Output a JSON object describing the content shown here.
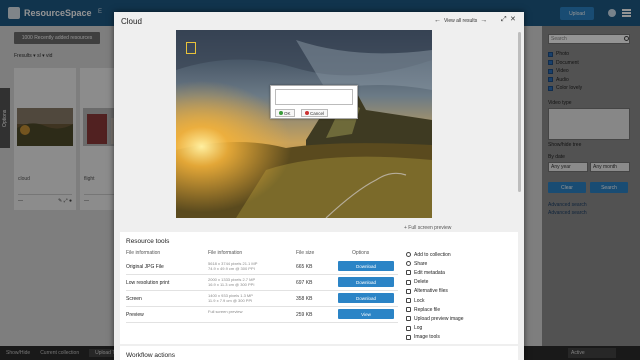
{
  "app": {
    "name": "ResourceSpace",
    "nav_text": "E",
    "upload_label": "Upload"
  },
  "background": {
    "collection_label": "1000 Recently added resources",
    "sort_text": "Fresults    ▾ sl   ▾   vid",
    "side_tab_label": "Options",
    "cards": [
      {
        "title": "cloud"
      },
      {
        "title": "flight"
      }
    ]
  },
  "sidebar": {
    "search_placeholder": "Search",
    "checks": [
      "Photo",
      "Document",
      "Video",
      "Audio",
      "Color lovely"
    ],
    "video_type_label": "Video type",
    "show_hide_label": "Show/hide tree",
    "by_date_label": "By date",
    "date_from": "Any year",
    "date_to": "Any month",
    "clear_label": "Clear",
    "search_label": "Search",
    "link1": "Advanced search",
    "link2": "Advanced search"
  },
  "bottombar": {
    "items": [
      "Show/Hide",
      "Current collection",
      "Upload Things",
      "▾"
    ],
    "right_select": "Active"
  },
  "modal": {
    "title": "Cloud",
    "nav_prev": "←",
    "nav_label": "View all results",
    "nav_next": "→",
    "full_preview_link": "+ Full screen preview",
    "annotate": {
      "ok_label": "OK",
      "cancel_label": "Cancel"
    },
    "resource_tools": {
      "title": "Resource tools",
      "columns": [
        "File information",
        "File information",
        "File size",
        "Options"
      ],
      "rows": [
        {
          "name": "Original JPG File",
          "info": "5618 x 3744 pixels 21.1 MP\n74.9 x 49.9 cm @ 300 PPI",
          "size": "665 KB",
          "button": "Download"
        },
        {
          "name": "Low resolution print",
          "info": "2000 x 1333 pixels 2.7 MP\n16.9 x 11.3 cm @ 300 PPI",
          "size": "697 KB",
          "button": "Download"
        },
        {
          "name": "Screen",
          "info": "1400 x 933 pixels 1.3 MP\n11.9 x 7.9 cm @ 300 PPI",
          "size": "358 KB",
          "button": "Download"
        },
        {
          "name": "Preview",
          "info": "Full screen preview",
          "size": "259 KB",
          "button": "View"
        }
      ],
      "actions": [
        "Add to collection",
        "Share",
        "Edit metadata",
        "Delete",
        "Alternative files",
        "Lock",
        "Replace file",
        "Upload preview image",
        "Log",
        "Image tools"
      ]
    },
    "workflow": {
      "title": "Workflow actions"
    }
  }
}
